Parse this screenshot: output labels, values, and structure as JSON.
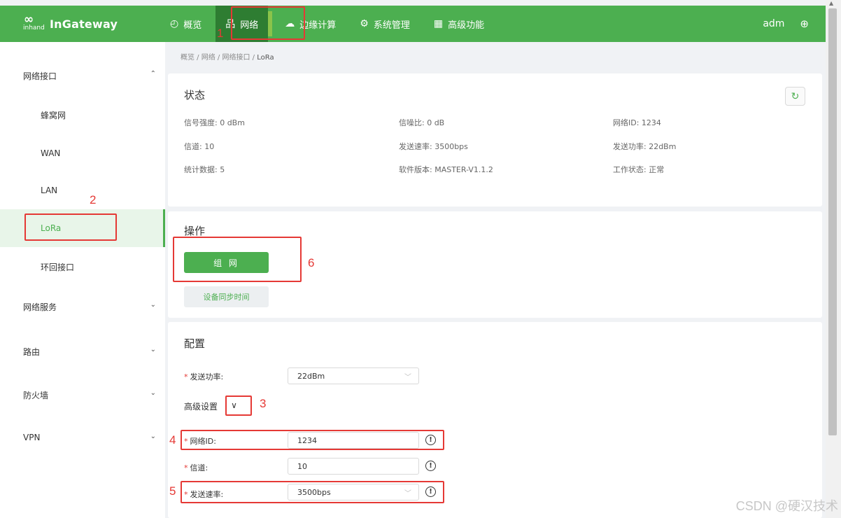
{
  "header": {
    "logo_mark": "inhand",
    "logo_text": "InGateway",
    "nav": [
      {
        "label": "概览",
        "icon": "dashboard-icon"
      },
      {
        "label": "网络",
        "icon": "network-icon"
      },
      {
        "label": "边缘计算",
        "icon": "cloud-icon"
      },
      {
        "label": "系统管理",
        "icon": "gear-icon"
      },
      {
        "label": "高级功能",
        "icon": "grid-icon"
      }
    ],
    "user": "adm"
  },
  "sidebar": {
    "group_network": "网络接口",
    "items": [
      "蜂窝网",
      "WAN",
      "LAN",
      "LoRa",
      "环回接口"
    ],
    "group_services": "网络服务",
    "group_routing": "路由",
    "group_firewall": "防火墙",
    "group_vpn": "VPN"
  },
  "breadcrumb": [
    "概览",
    "网络",
    "网络接口",
    "LoRa"
  ],
  "status": {
    "title": "状态",
    "signal": "信号强度: 0 dBm",
    "snr": "信噪比: 0 dB",
    "netid": "网络ID: 1234",
    "channel": "信道: 10",
    "rate": "发送速率: 3500bps",
    "power": "发送功率: 22dBm",
    "stats": "统计数据: 5",
    "version": "软件版本: MASTER-V1.1.2",
    "work": "工作状态: 正常"
  },
  "ops": {
    "title": "操作",
    "network_btn": "组 网",
    "sync_btn": "设备同步时间"
  },
  "config": {
    "title": "配置",
    "power_label": "发送功率:",
    "power_value": "22dBm",
    "advanced_label": "高级设置",
    "netid_label": "网络ID:",
    "netid_value": "1234",
    "channel_label": "信道:",
    "channel_value": "10",
    "rate_label": "发送速率:",
    "rate_value": "3500bps"
  },
  "annotations": [
    "1",
    "2",
    "3",
    "4",
    "5",
    "6"
  ],
  "watermark": "CSDN @硬汉技术",
  "colors": {
    "brand": "#4caf50",
    "brand_dark": "#2e7d32",
    "annotation": "#e53935"
  }
}
